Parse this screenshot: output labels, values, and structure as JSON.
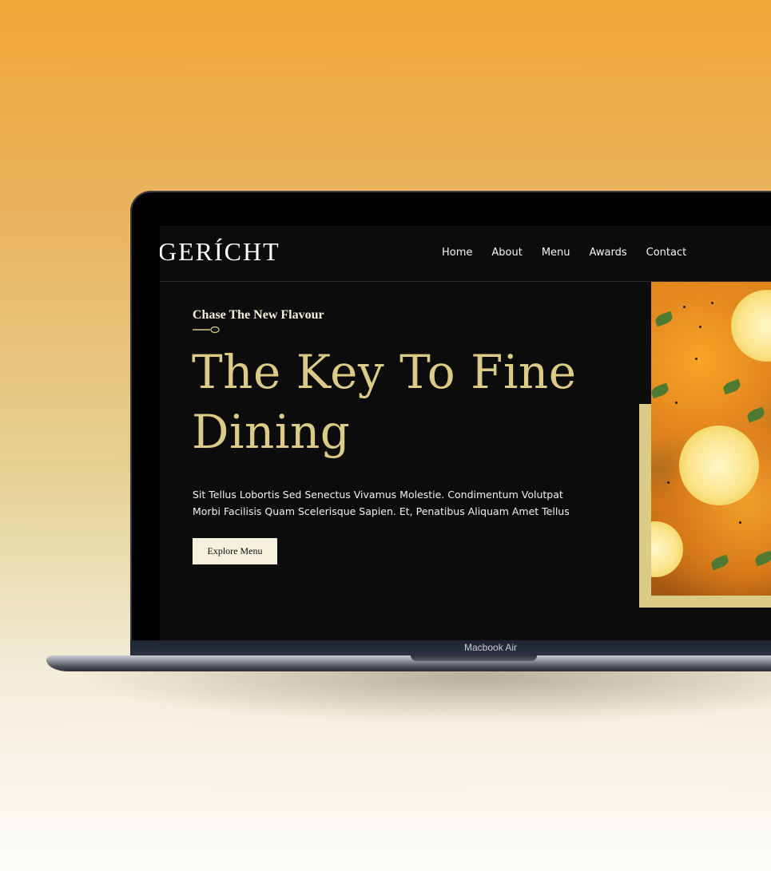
{
  "site": {
    "logo": "GERÍCHT",
    "nav": [
      "Home",
      "About",
      "Menu",
      "Awards",
      "Contact"
    ]
  },
  "hero": {
    "tagline": "Chase The New Flavour",
    "headline": "The Key To Fine Dining",
    "description": "Sit Tellus Lobortis Sed Senectus Vivamus Molestie. Condimentum Volutpat Morbi Facilisis Quam Scelerisque Sapien. Et, Penatibus Aliquam Amet Tellus",
    "cta_label": "Explore Menu"
  },
  "device": {
    "label": "Macbook Air"
  },
  "colors": {
    "gold": "#dcca87",
    "cream": "#f5efdb",
    "screen_bg": "#0c0c0c"
  },
  "icons": {
    "spoon": "spoon-icon"
  }
}
